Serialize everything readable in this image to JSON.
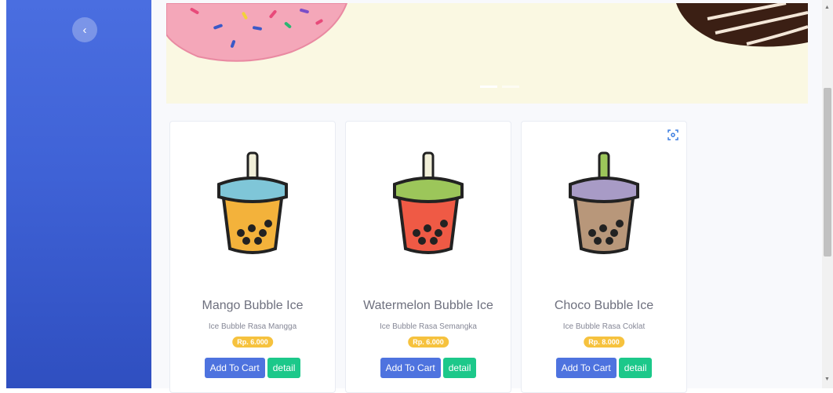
{
  "sidebar": {
    "toggle_icon": "‹"
  },
  "products": [
    {
      "name": "Mango Bubble Ice",
      "description": "Ice Bubble Rasa Mangga",
      "price": "Rp. 6.000",
      "drink_color": "#f3b23b",
      "lid_color": "#7fc6d8",
      "cart_label": "Add To Cart",
      "detail_label": "detail"
    },
    {
      "name": "Watermelon Bubble Ice",
      "description": "Ice Bubble Rasa Semangka",
      "price": "Rp. 6.000",
      "drink_color": "#ef5a45",
      "lid_color": "#9cc65a",
      "cart_label": "Add To Cart",
      "detail_label": "detail"
    },
    {
      "name": "Choco Bubble Ice",
      "description": "Ice Bubble Rasa Coklat",
      "price": "Rp. 8.000",
      "drink_color": "#b8977a",
      "lid_color": "#a89bc6",
      "cart_label": "Add To Cart",
      "detail_label": "detail"
    }
  ],
  "colors": {
    "primary": "#4e73df",
    "success": "#1cc88a",
    "warning": "#f6c23e"
  }
}
